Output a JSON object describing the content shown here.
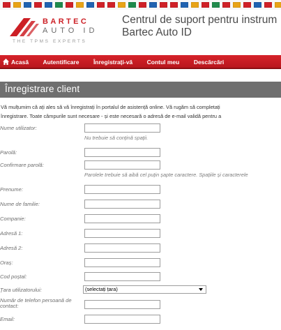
{
  "flags": [
    "#cf2027",
    "#e8a316",
    "#1f62b0",
    "#cf2027",
    "#1f62b0",
    "#1f8a4c",
    "#cf2027",
    "#e8a316",
    "#1f62b0",
    "#cf2027",
    "#cf2027",
    "#e8a316",
    "#1f8a4c",
    "#cf2027",
    "#1f62b0",
    "#cf2027",
    "#cf2027",
    "#1f62b0",
    "#e8a316",
    "#cf2027",
    "#1f8a4c",
    "#cf2027",
    "#e8a316",
    "#cf2027",
    "#1f62b0",
    "#cf2027",
    "#e8a316",
    "#1f8a4c",
    "#cf2027",
    "#1f62b0"
  ],
  "logo": {
    "brand": "BARTEC",
    "auto": "AUTO ID",
    "tagline": "THE TPMS EXPERTS"
  },
  "site": {
    "title_line1": "Centrul de suport pentru instrum",
    "title_line2": "Bartec Auto ID"
  },
  "nav": [
    "Acasă",
    "Autentificare",
    "Înregistrați-vă",
    "Contul meu",
    "Descărcări"
  ],
  "section_title": "Înregistrare client",
  "intro": {
    "line1": "Vă mulțumim că ați ales să vă înregistrați în portalul de asistență online. Vă rugăm să completați",
    "line2": "înregistrare. Toate câmpurile sunt necesare - și este necesară o adresă de e-mail validă pentru a"
  },
  "form": {
    "username_label": "Nume utilizator:",
    "username_hint": "Nu trebuie să conțină spații.",
    "password_label": "Parolă:",
    "confirm_label": "Confirmare parolă:",
    "password_hint": "Parolele trebuie să aibă cel puțin șapte caractere. Spațiile și caracterele",
    "firstname_label": "Prenume:",
    "lastname_label": "Nume de familie:",
    "company_label": "Companie:",
    "address1_label": "Adresă 1:",
    "address2_label": "Adresă 2:",
    "city_label": "Oraș:",
    "postcode_label": "Cod poștal:",
    "country_label": "Țara utilizatorului:",
    "country_selected": "(selectați țara)",
    "phone_label": "Număr de telefon persoană de contact:",
    "email_label": "Email:"
  },
  "colors": {
    "accent_red": "#cc1f25",
    "section_gray": "#6f6f6f"
  }
}
